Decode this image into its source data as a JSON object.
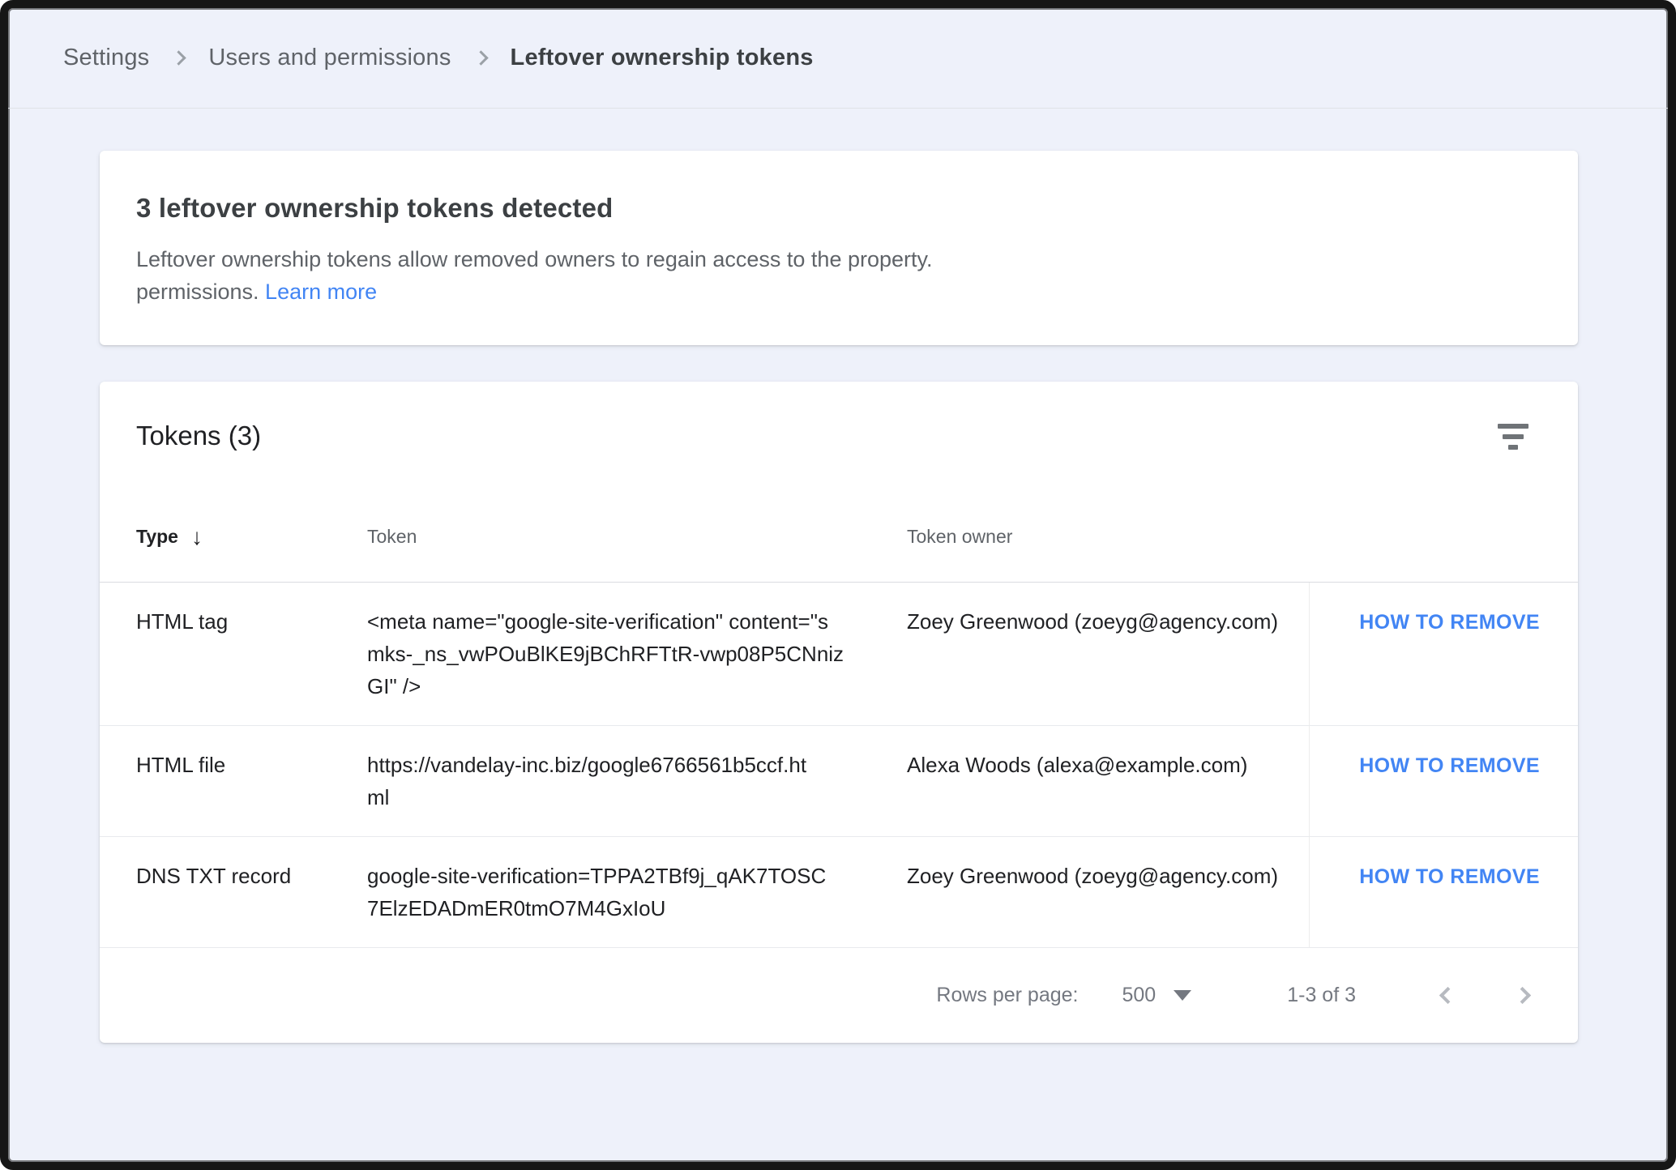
{
  "colors": {
    "page_background": "#eef1fa",
    "accent_blue": "#4285f4",
    "text_primary": "#202124",
    "text_secondary": "#5f6368"
  },
  "breadcrumb": {
    "items": [
      {
        "label": "Settings"
      },
      {
        "label": "Users and permissions"
      },
      {
        "label": "Leftover ownership tokens"
      }
    ]
  },
  "alert_card": {
    "title": "3 leftover ownership tokens detected",
    "description_line1": "Leftover ownership tokens allow removed owners to regain access to the property.",
    "description_line2_prefix": "permissions. ",
    "learn_more_label": "Learn more"
  },
  "tokens_card": {
    "title": "Tokens (3)",
    "filter_icon": "filter-icon",
    "columns": {
      "type": "Type",
      "sort_arrow": "↓",
      "token": "Token",
      "owner": "Token owner"
    },
    "rows": [
      {
        "type": "HTML tag",
        "token": "<meta name=\"google-site-verification\" content=\"smks-_ns_vwPOuBlKE9jBChRFTtR-vwp08P5CNnizGI\" />",
        "token_lines": {
          "0": "<meta name=\"google-site-verification\" content=\"s",
          "1": "mks-_ns_vwPOuBlKE9jBChRFTtR-vwp08P5CNniz",
          "2": "GI\" />"
        },
        "owner": "Zoey Greenwood (zoeyg@agency.com)",
        "action": "HOW TO REMOVE"
      },
      {
        "type": "HTML file",
        "token": "https://vandelay-inc.biz/google6766561b5ccf.html",
        "token_lines": {
          "0": "https://vandelay-inc.biz/google6766561b5ccf.ht",
          "1": "ml"
        },
        "owner": "Alexa Woods (alexa@example.com)",
        "action": "HOW TO REMOVE"
      },
      {
        "type": "DNS TXT record",
        "token": "google-site-verification=TPPA2TBf9j_qAK7TOSC7ElzEDADmER0tmO7M4GxIoU",
        "token_lines": {
          "0": "google-site-verification=TPPA2TBf9j_qAK7TOSC",
          "1": "7ElzEDADmER0tmO7M4GxIoU"
        },
        "owner": "Zoey Greenwood (zoeyg@agency.com)",
        "action": "HOW TO REMOVE"
      }
    ],
    "pagination": {
      "rows_per_page_label": "Rows per page:",
      "rows_per_page_value": "500",
      "range": "1-3 of 3"
    }
  }
}
